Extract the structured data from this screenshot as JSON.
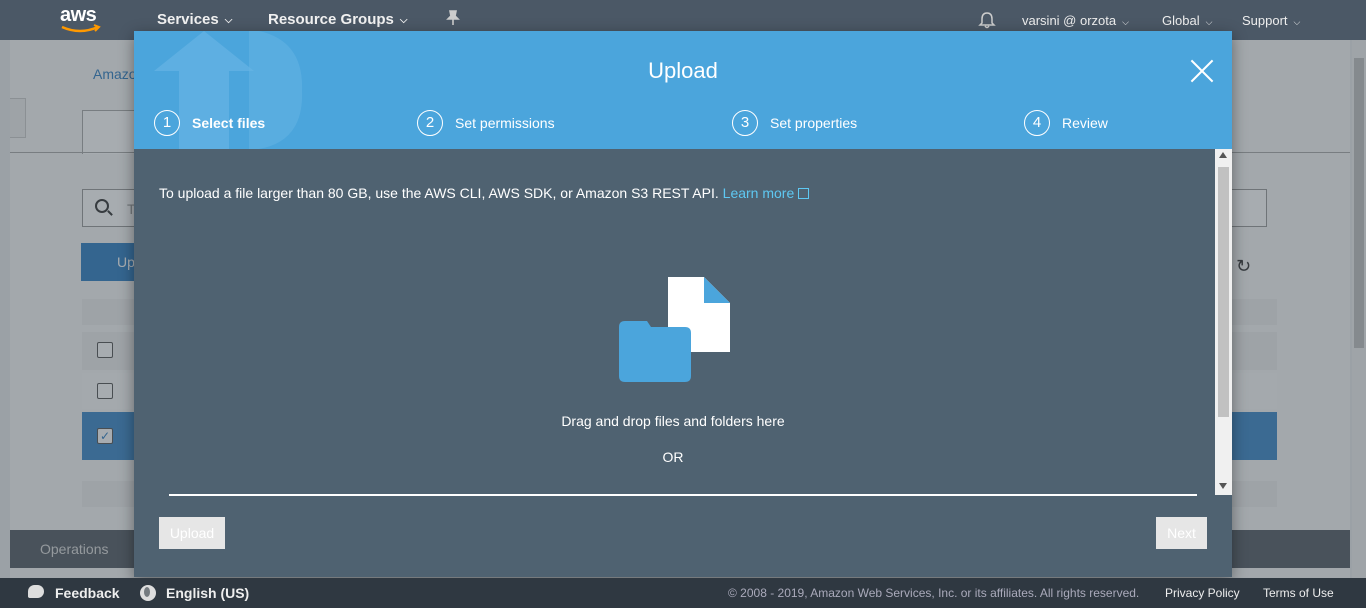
{
  "topnav": {
    "logo_text": "aws",
    "services": "Services",
    "resource_groups": "Resource Groups",
    "user": "varsini @ orzota",
    "region": "Global",
    "support": "Support"
  },
  "background": {
    "breadcrumb": "Amazo",
    "search_placeholder": "T",
    "upload_label": "Up",
    "operations": "Operations"
  },
  "modal": {
    "title": "Upload",
    "steps": [
      {
        "num": "1",
        "label": "Select files"
      },
      {
        "num": "2",
        "label": "Set permissions"
      },
      {
        "num": "3",
        "label": "Set properties"
      },
      {
        "num": "4",
        "label": "Review"
      }
    ],
    "info_text": "To upload a file larger than 80 GB, use the AWS CLI, AWS SDK, or Amazon S3 REST API.",
    "learn_more": "Learn more",
    "drop_text": "Drag and drop files and folders here",
    "or_text": "OR",
    "upload_button": "Upload",
    "next_button": "Next"
  },
  "footer": {
    "feedback": "Feedback",
    "language": "English (US)",
    "copyright": "© 2008 - 2019, Amazon Web Services, Inc. or its affiliates. All rights reserved.",
    "privacy": "Privacy Policy",
    "terms": "Terms of Use"
  },
  "colors": {
    "nav_bg": "#4b5866",
    "modal_header": "#4ba5dc",
    "modal_body": "#4f6271",
    "link": "#5ec8f2",
    "footer_bg": "#2f3841"
  }
}
